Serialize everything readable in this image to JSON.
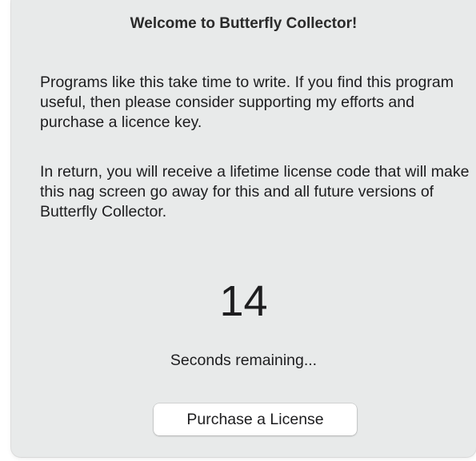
{
  "dialog": {
    "title": "Welcome to Butterfly Collector!",
    "paragraph1": "Programs like this take time to write. If you find this program useful, then please consider supporting my efforts and purchase a licence key.",
    "paragraph2": "In return, you will receive a lifetime license code that will make this nag screen go away for this and all future versions of Butterfly Collector.",
    "countdown": "14",
    "countdown_label": "Seconds remaining...",
    "purchase_button_label": "Purchase a License"
  }
}
